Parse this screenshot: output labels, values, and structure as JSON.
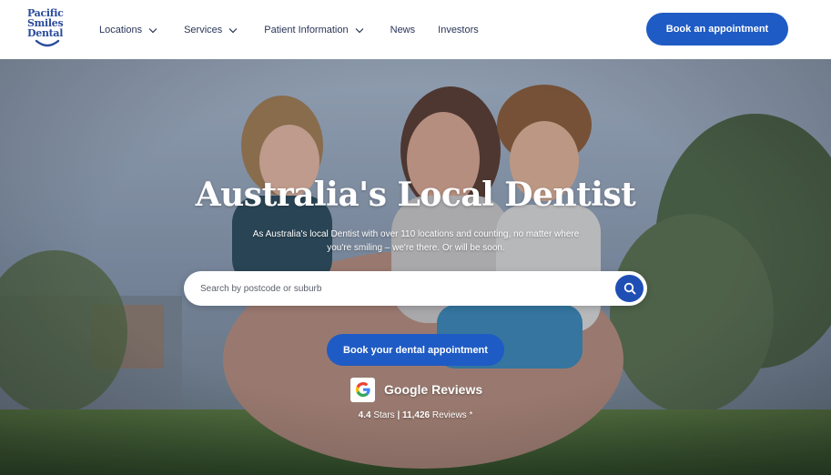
{
  "brand": {
    "logo_lines": [
      "Pacific",
      "Smiles",
      "Dental"
    ],
    "color": "#2a4b9b",
    "accent": "#1f5bc4"
  },
  "nav": {
    "items": [
      {
        "label": "Locations",
        "has_dropdown": true
      },
      {
        "label": "Services",
        "has_dropdown": true
      },
      {
        "label": "Patient Information",
        "has_dropdown": true
      },
      {
        "label": "News",
        "has_dropdown": false
      },
      {
        "label": "Investors",
        "has_dropdown": false
      }
    ],
    "book_label": "Book an appointment"
  },
  "hero": {
    "title": "Australia's Local Dentist",
    "subtitle": "As Australia's local Dentist with over 110 locations and counting, no matter where you're smiling – we're there. Or will be soon.",
    "search": {
      "placeholder": "Search by postcode or suburb",
      "value": "",
      "icon": "search-icon"
    },
    "book_label": "Book your dental appointment",
    "reviews": {
      "title": "Google Reviews",
      "stars": "4.4",
      "stars_label": "Stars",
      "separator": "|",
      "count": "11,426",
      "count_label": "Reviews *"
    }
  }
}
